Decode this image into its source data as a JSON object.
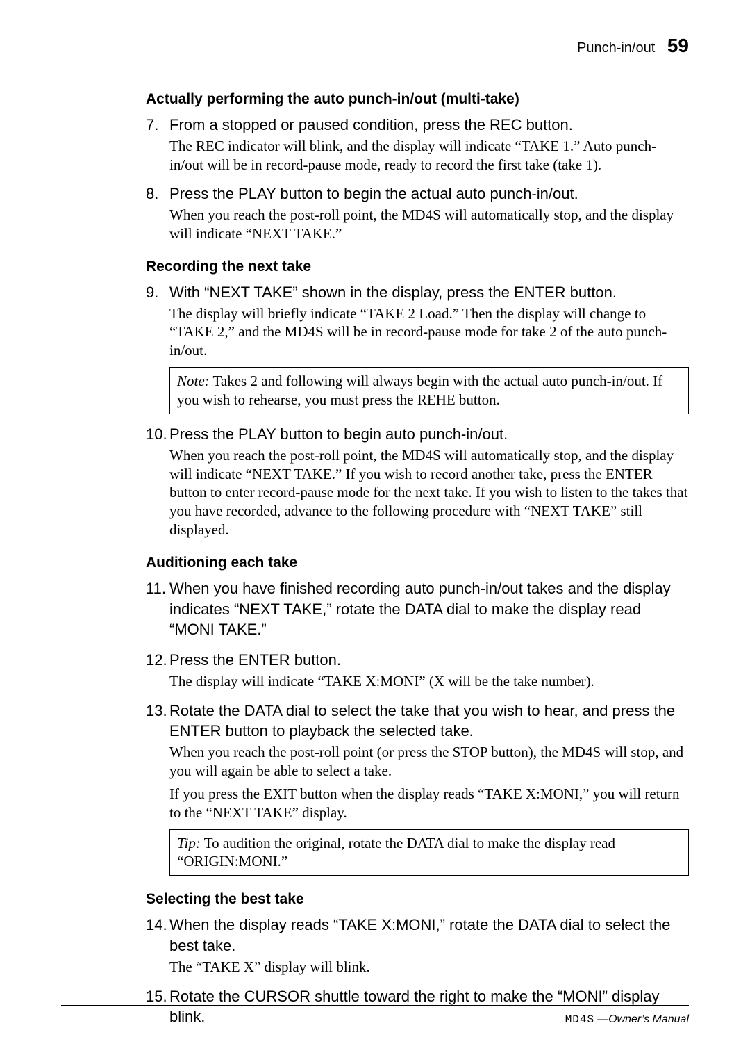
{
  "header": {
    "section": "Punch-in/out",
    "page_number": "59"
  },
  "content": {
    "h1": "Actually performing the auto punch-in/out (multi-take)",
    "s7": {
      "num": "7.",
      "head": "From a stopped or paused condition, press the REC button.",
      "body": "The REC indicator will blink, and the display will indicate “TAKE 1.” Auto punch-in/out will be in record-pause mode, ready to record the first take (take 1)."
    },
    "s8": {
      "num": "8.",
      "head": "Press the PLAY button to begin the actual auto punch-in/out.",
      "body": "When you reach the post-roll point, the MD4S will automatically stop, and the display will indicate “NEXT TAKE.”"
    },
    "h2": "Recording the next take",
    "s9": {
      "num": "9.",
      "head": "With “NEXT TAKE” shown in the display, press the ENTER button.",
      "body": "The display will briefly indicate “TAKE 2 Load.” Then the display will change to “TAKE 2,” and the MD4S will be in record-pause mode for take 2 of the auto punch-in/out."
    },
    "note1": {
      "label": "Note:",
      "text": "  Takes 2 and following will always begin with the actual auto punch-in/out. If you wish to rehearse, you must press the REHE button."
    },
    "s10": {
      "num": "10.",
      "head": "Press the PLAY button to begin auto punch-in/out.",
      "body": "When you reach the post-roll point, the MD4S will automatically stop, and the display will indicate “NEXT TAKE.” If you wish to record another take, press the ENTER button to enter record-pause mode for the next take. If you wish to listen to the takes that you have recorded, advance to the following procedure with “NEXT TAKE” still displayed."
    },
    "h3": "Auditioning each take",
    "s11": {
      "num": "11.",
      "head": "When you have finished recording auto punch-in/out takes and the display indicates “NEXT TAKE,” rotate the DATA dial to make the display read “MONI TAKE.”"
    },
    "s12": {
      "num": "12.",
      "head": "Press the ENTER button.",
      "body": "The display will indicate “TAKE X:MONI” (X will be the take number)."
    },
    "s13": {
      "num": "13.",
      "head": "Rotate the DATA dial to select the take that you wish to hear, and press the ENTER button to playback the selected take.",
      "body1": "When you reach the post-roll point (or press the STOP button), the MD4S will stop, and you will again be able to select a take.",
      "body2": "If you press the EXIT button when the display reads “TAKE X:MONI,” you will return to the “NEXT TAKE” display."
    },
    "tip1": {
      "label": "Tip:",
      "text": "   To audition the original, rotate the DATA dial to make the display read “ORIGIN:MONI.”"
    },
    "h4": "Selecting the best take",
    "s14": {
      "num": "14.",
      "head": "When the display reads “TAKE X:MONI,” rotate the DATA dial to select the best take.",
      "body": "The “TAKE X” display will blink."
    },
    "s15": {
      "num": "15.",
      "head": "Rotate the CURSOR shuttle toward the right to make the “MONI” display blink."
    }
  },
  "footer": {
    "logo": "MD4S",
    "text": "—Owner’s Manual"
  }
}
